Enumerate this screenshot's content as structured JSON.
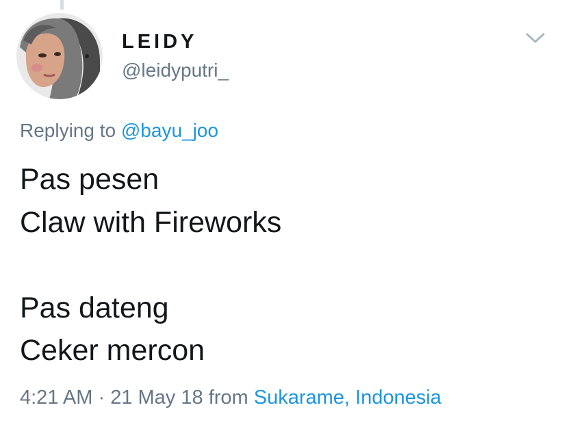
{
  "tweet": {
    "author": {
      "display_name": "LEIDY",
      "handle": "@leidyputri_"
    },
    "reply": {
      "prefix": "Replying to",
      "to_handle": "@bayu_joo"
    },
    "text_lines": [
      "Pas pesen",
      "Claw with Fireworks",
      "",
      "Pas dateng",
      "Ceker mercon"
    ],
    "meta": {
      "time": "4:21 AM",
      "separator": "·",
      "date": "21 May 18",
      "from_label": "from",
      "location": "Sukarame, Indonesia"
    },
    "icons": {
      "menu": "chevron-down-icon",
      "avatar": "profile-photo"
    },
    "colors": {
      "text": "#14171a",
      "secondary": "#657786",
      "link": "#1b95e0"
    }
  }
}
